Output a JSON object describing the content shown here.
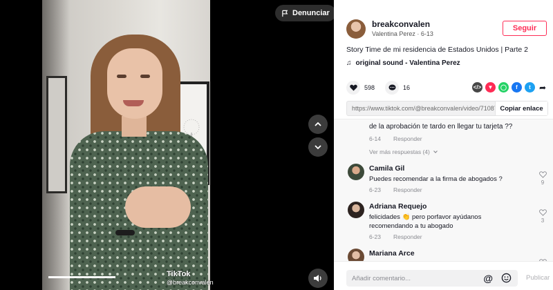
{
  "video": {
    "report_label": "Denunciar",
    "watermark_brand": "TikTok",
    "watermark_handle": "@breakconvalen",
    "progress_fraction": 0.4
  },
  "author": {
    "username": "breakconvalen",
    "display_name": "Valentina Perez",
    "separator": " · ",
    "date": "6-13",
    "follow_label": "Seguir"
  },
  "post": {
    "description": "Story Time de mi residencia de Estados Unidos | Parte 2",
    "sound": "original sound - Valentina Perez",
    "likes": "598",
    "comments": "16",
    "link": "https://www.tiktok.com/@breakconvalen/video/710879...",
    "copy_label": "Copiar enlace"
  },
  "comments": {
    "partial_text": "de la aprobación te tardo en llegar tu tarjeta ??",
    "partial_date": "6-14",
    "reply_label": "Responder",
    "view_more": "Ver más respuestas (4)",
    "items": [
      {
        "name": "Camila Gil",
        "text": "Puedes recomendar a la firma de abogados ?",
        "date": "6-23",
        "likes": "9"
      },
      {
        "name": "Adriana Requejo",
        "text": "felicidades 👏 pero porfavor ayúdanos recomendando a tu abogado",
        "date": "6-23",
        "likes": "3"
      },
      {
        "name": "Mariana Arce",
        "text": "",
        "date": "",
        "likes": ""
      }
    ]
  },
  "composer": {
    "placeholder": "Añadir comentario...",
    "post_label": "Publicar"
  },
  "colors": {
    "accent": "#fe2c55",
    "panel_bg": "#ffffff",
    "comments_bg": "#f8f8f8"
  }
}
